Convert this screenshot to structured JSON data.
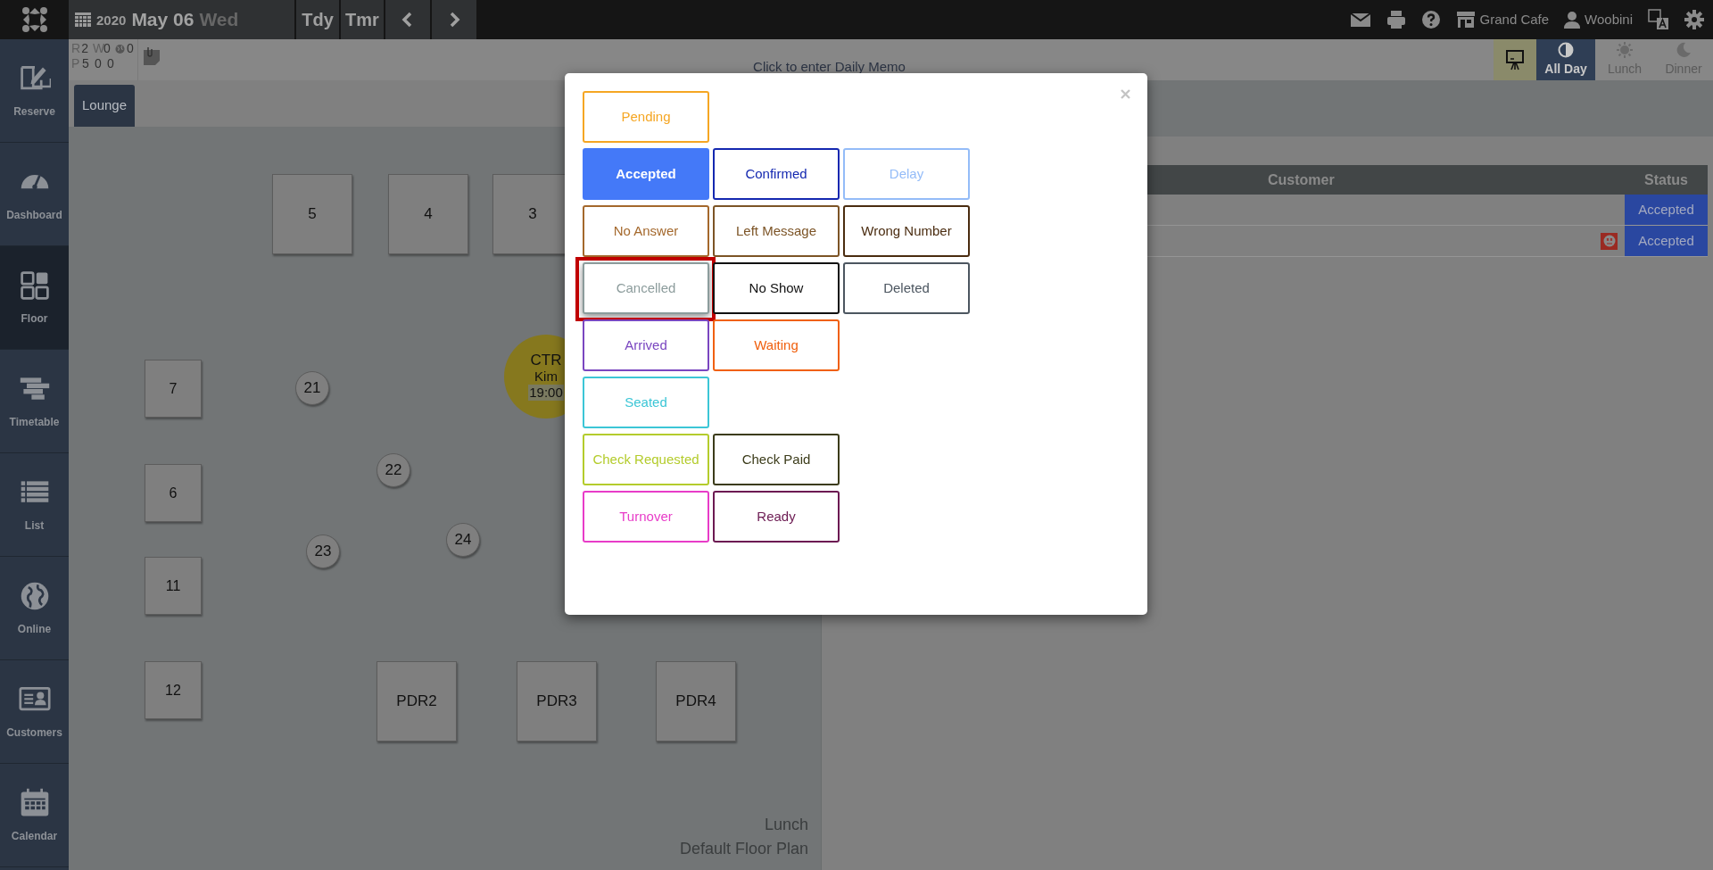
{
  "top_bar": {
    "year": "2020",
    "date": "May 06",
    "weekday": "Wed",
    "nav_buttons": [
      "Tdy",
      "Tmr"
    ],
    "venue": "Grand Cafe",
    "user": "Woobini"
  },
  "sidebar": {
    "items": [
      {
        "label": "Reserve",
        "selected": false
      },
      {
        "label": "Dashboard",
        "selected": false
      },
      {
        "label": "Floor",
        "selected": true
      },
      {
        "label": "Timetable",
        "selected": false
      },
      {
        "label": "List",
        "selected": false
      },
      {
        "label": "Online",
        "selected": false
      },
      {
        "label": "Customers",
        "selected": false
      },
      {
        "label": "Calendar",
        "selected": false
      }
    ]
  },
  "counters": [
    [
      {
        "kind": "label",
        "text": "R"
      },
      {
        "kind": "value",
        "text": "2"
      },
      {
        "kind": "label",
        "text": "W"
      },
      {
        "kind": "value",
        "text": "0"
      },
      {
        "kind": "online",
        "text": "0"
      }
    ],
    [
      {
        "kind": "label",
        "text": "P"
      },
      {
        "kind": "value",
        "text": "5"
      },
      {
        "kind": "value",
        "text": "0"
      },
      {
        "kind": "value",
        "text": "0"
      }
    ]
  ],
  "daily_memo": "Click to enter Daily Memo",
  "period_tabs": [
    {
      "label": "All Day",
      "selected": true
    },
    {
      "label": "Lunch",
      "selected": false
    },
    {
      "label": "Dinner",
      "selected": false
    }
  ],
  "floor_tabs": [
    {
      "label": "Lounge",
      "selected": true
    }
  ],
  "floor_tables": [
    {
      "kind": "square",
      "label": "5"
    },
    {
      "kind": "square",
      "label": "4"
    },
    {
      "kind": "square",
      "label": "3"
    },
    {
      "kind": "small",
      "label": "7"
    },
    {
      "kind": "small",
      "label": "6"
    },
    {
      "kind": "small",
      "label": "11"
    },
    {
      "kind": "small",
      "label": "12"
    },
    {
      "kind": "round",
      "label": "21"
    },
    {
      "kind": "round",
      "label": "22"
    },
    {
      "kind": "round",
      "label": "23"
    },
    {
      "kind": "round",
      "label": "24"
    },
    {
      "kind": "booked",
      "label": "CTR",
      "guest": "Kim",
      "time": "19:00"
    },
    {
      "kind": "square",
      "label": "PDR2"
    },
    {
      "kind": "square",
      "label": "PDR3"
    },
    {
      "kind": "square",
      "label": "PDR4"
    }
  ],
  "floor_footer": {
    "shift": "Lunch",
    "plan": "Default Floor Plan"
  },
  "reservations": {
    "columns": [
      "Customer",
      "Status"
    ],
    "rows": [
      {
        "status": "Accepted",
        "warning": false
      },
      {
        "status": "Accepted",
        "warning": true
      }
    ]
  },
  "status_dialog": {
    "rows": [
      [
        {
          "label": "Pending",
          "color": "#f5a623",
          "selected": false,
          "highlighted": false
        }
      ],
      [
        {
          "label": "Accepted",
          "color": "#4479f8",
          "selected": true,
          "highlighted": false
        },
        {
          "label": "Confirmed",
          "color": "#1428b0",
          "selected": false,
          "highlighted": false
        },
        {
          "label": "Delay",
          "color": "#94bcf8",
          "selected": false,
          "highlighted": false
        }
      ],
      [
        {
          "label": "No Answer",
          "color": "#a4682c",
          "selected": false,
          "highlighted": false
        },
        {
          "label": "Left Message",
          "color": "#7c5426",
          "selected": false,
          "highlighted": false
        },
        {
          "label": "Wrong Number",
          "color": "#4a2c10",
          "selected": false,
          "highlighted": false
        }
      ],
      [
        {
          "label": "Cancelled",
          "color": "#8c9c9c",
          "selected": false,
          "highlighted": true
        },
        {
          "label": "No Show",
          "color": "#111111",
          "selected": false,
          "highlighted": false
        },
        {
          "label": "Deleted",
          "color": "#4c5660",
          "selected": false,
          "highlighted": false
        }
      ],
      [
        {
          "label": "Arrived",
          "color": "#7a46c0",
          "selected": false,
          "highlighted": false
        },
        {
          "label": "Waiting",
          "color": "#f0600e",
          "selected": false,
          "highlighted": false
        }
      ],
      [
        {
          "label": "Seated",
          "color": "#3cc6d6",
          "selected": false,
          "highlighted": false
        }
      ],
      [
        {
          "label": "Check Requested",
          "color": "#b4cc2c",
          "selected": false,
          "highlighted": false
        },
        {
          "label": "Check Paid",
          "color": "#3c3c1a",
          "selected": false,
          "highlighted": false
        }
      ],
      [
        {
          "label": "Turnover",
          "color": "#e83cc8",
          "selected": false,
          "highlighted": false
        },
        {
          "label": "Ready",
          "color": "#6c1a52",
          "selected": false,
          "highlighted": false
        }
      ]
    ]
  }
}
